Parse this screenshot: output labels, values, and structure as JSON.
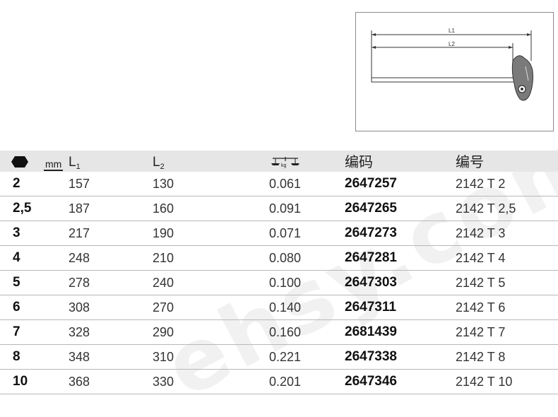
{
  "diagram": {
    "dimension_l1": "L1",
    "dimension_l2": "L2"
  },
  "watermark": "ehsy.com",
  "table": {
    "headers": {
      "size_unit": "mm",
      "l1_main": "L",
      "l1_sub": "1",
      "l2_main": "L",
      "l2_sub": "2",
      "weight_unit": "kg",
      "code": "编码",
      "number": "编号"
    },
    "rows": [
      {
        "size": "2",
        "l1": "157",
        "l2": "130",
        "weight": "0.061",
        "code": "2647257",
        "number": "2142 T 2"
      },
      {
        "size": "2,5",
        "l1": "187",
        "l2": "160",
        "weight": "0.091",
        "code": "2647265",
        "number": "2142 T 2,5"
      },
      {
        "size": "3",
        "l1": "217",
        "l2": "190",
        "weight": "0.071",
        "code": "2647273",
        "number": "2142 T 3"
      },
      {
        "size": "4",
        "l1": "248",
        "l2": "210",
        "weight": "0.080",
        "code": "2647281",
        "number": "2142 T 4"
      },
      {
        "size": "5",
        "l1": "278",
        "l2": "240",
        "weight": "0.100",
        "code": "2647303",
        "number": "2142 T 5"
      },
      {
        "size": "6",
        "l1": "308",
        "l2": "270",
        "weight": "0.140",
        "code": "2647311",
        "number": "2142 T 6"
      },
      {
        "size": "7",
        "l1": "328",
        "l2": "290",
        "weight": "0.160",
        "code": "2681439",
        "number": "2142 T 7"
      },
      {
        "size": "8",
        "l1": "348",
        "l2": "310",
        "weight": "0.221",
        "code": "2647338",
        "number": "2142 T 8"
      },
      {
        "size": "10",
        "l1": "368",
        "l2": "330",
        "weight": "0.201",
        "code": "2647346",
        "number": "2142 T 10"
      }
    ]
  }
}
